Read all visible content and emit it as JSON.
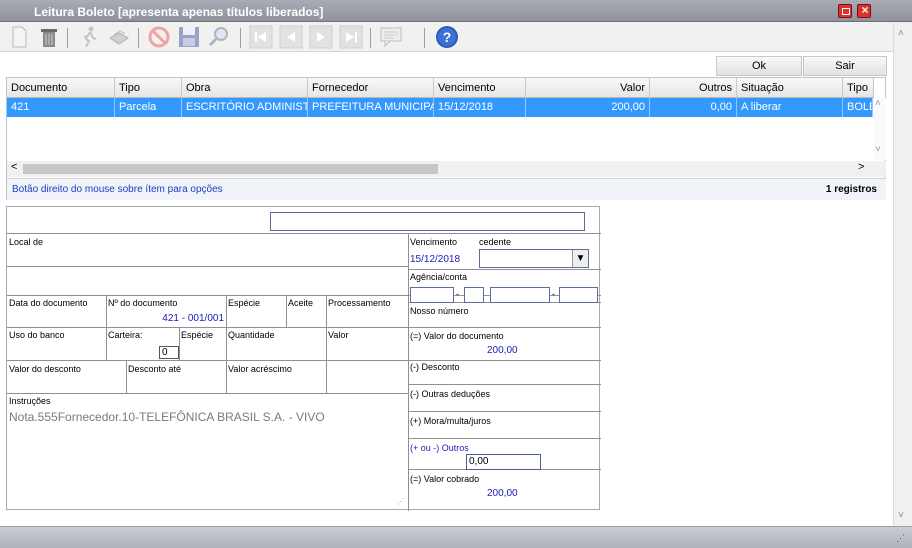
{
  "window": {
    "title": "Leitura Boleto [apresenta apenas títulos liberados]",
    "accent": "#d9322f"
  },
  "toolbar": {
    "icons": [
      "new-icon",
      "delete-icon",
      "run-icon",
      "print-icon",
      "cancel-icon",
      "save-icon",
      "search-icon",
      "first-icon",
      "prev-icon",
      "next-icon",
      "last-icon",
      "comment-icon",
      "help-icon"
    ]
  },
  "actions": {
    "ok_label": "Ok",
    "exit_label": "Sair"
  },
  "grid": {
    "columns": [
      "Documento",
      "Tipo",
      "Obra",
      "Fornecedor",
      "Vencimento",
      "Valor",
      "Outros",
      "Situação",
      "Tipo"
    ],
    "rows": [
      [
        "421",
        "Parcela",
        "ESCRITÓRIO ADMINISTRA",
        "PREFEITURA MUNICIPAL",
        "15/12/2018",
        "200,00",
        "0,00",
        "A liberar",
        "BOLETO"
      ]
    ],
    "selection_color": "#3399ff"
  },
  "status": {
    "hint": "Botão direito do mouse sobre ítem para opções",
    "count": "1 registros"
  },
  "boleto": {
    "local_label": "Local de",
    "vencimento_label": "Vencimento",
    "cedente_label": "cedente",
    "vencimento_value": "15/12/2018",
    "agencia_label": "Agência/conta",
    "dash": "-",
    "data_doc_label": "Data do documento",
    "num_doc_label": "Nº do documento",
    "num_doc_value": "421 - 001/001",
    "especie_label": "Espécie",
    "aceite_label": "Aceite",
    "processamento_label": "Processamento",
    "nosso_numero_label": "Nosso número",
    "uso_banco_label": "Uso do banco",
    "carteira_label": "Carteira:",
    "carteira_value": "0",
    "especie2_label": "Espécie",
    "quantidade_label": "Quantidade",
    "valor_label": "Valor",
    "valor_doc_label": "(=) Valor do documento",
    "valor_doc_value": "200,00",
    "valor_desconto_label": "Valor do desconto",
    "desconto_ate_label": "Desconto até",
    "valor_acrescimo_label": "Valor acréscimo",
    "desconto_label": "(-) Desconto",
    "outras_deducoes_label": "(-) Outras deduções",
    "instrucoes_label": "Instruções",
    "instrucoes_text": "Nota.555Fornecedor.10-TELEFÔNICA BRASIL S.A. - VIVO",
    "mora_label": "(+) Mora/multa/juros",
    "outros_label": "(+ ou -) Outros",
    "outros_value": "0,00",
    "valor_cobrado_label": "(=) Valor cobrado",
    "valor_cobrado_value": "200,00"
  }
}
